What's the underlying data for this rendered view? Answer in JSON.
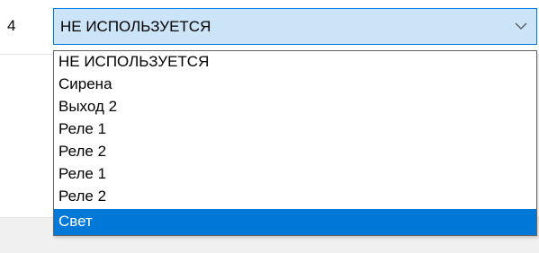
{
  "row": {
    "number": "4"
  },
  "combobox": {
    "selected_value": "НЕ ИСПОЛЬЗУЕТСЯ",
    "arrow_icon": "chevron-down-icon"
  },
  "dropdown": {
    "items": [
      {
        "label": "НЕ ИСПОЛЬЗУЕТСЯ",
        "selected": false
      },
      {
        "label": "Сирена",
        "selected": false
      },
      {
        "label": "Выход 2",
        "selected": false
      },
      {
        "label": "Реле 1",
        "selected": false
      },
      {
        "label": "Реле 2",
        "selected": false
      },
      {
        "label": "Реле 1",
        "selected": false
      },
      {
        "label": "Реле 2",
        "selected": false
      },
      {
        "label": "Свет",
        "selected": true
      }
    ]
  },
  "colors": {
    "combobox_border": "#0078d7",
    "combobox_fill": "#cce4f7",
    "selection_highlight": "#0078d7"
  }
}
